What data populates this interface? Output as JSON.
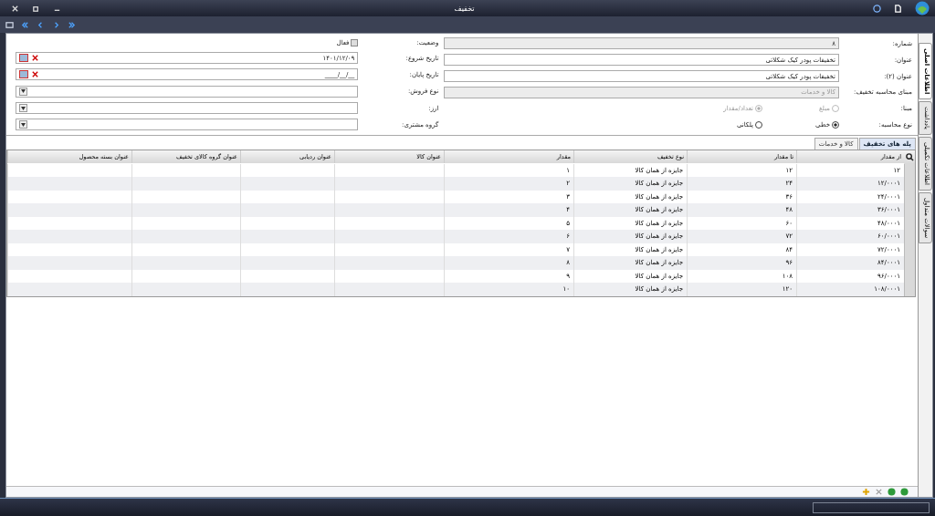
{
  "window": {
    "title": "تخفیف"
  },
  "side_tabs": [
    {
      "label": "اطلاعات اصلی",
      "selected": true
    },
    {
      "label": "یادداشت",
      "selected": false
    },
    {
      "label": "اطلاعات تکمیلی",
      "selected": false
    },
    {
      "label": "سوالات متداول",
      "selected": false
    }
  ],
  "form_right": [
    {
      "kind": "text",
      "label": "شماره:",
      "value": "۸",
      "disabled": true
    },
    {
      "kind": "text",
      "label": "عنوان:",
      "value": "تخفیفات پودر کیک شکلاتی",
      "disabled": false
    },
    {
      "kind": "text",
      "label": "عنوان (۲):",
      "value": "تخفیفات پودر کیک شکلاتی",
      "disabled": false
    },
    {
      "kind": "select",
      "label": "مبنای محاسبه تخفیف:",
      "value": "کالا و خدمات",
      "disabled": true
    },
    {
      "kind": "radio",
      "label": "مبنا:",
      "disabled": true,
      "options": [
        {
          "label": "مبلغ",
          "selected": false
        },
        {
          "label": "تعداد/مقدار",
          "selected": true
        }
      ]
    },
    {
      "kind": "radio",
      "label": "نوع محاسبه:",
      "disabled": false,
      "options": [
        {
          "label": "خطی",
          "selected": true
        },
        {
          "label": "پلکانی",
          "selected": false
        }
      ]
    }
  ],
  "form_left": [
    {
      "kind": "checkbox",
      "label": "وضعیت:",
      "option": "فعال",
      "checked": false
    },
    {
      "kind": "date",
      "label": "تاریخ شروع:",
      "value": "۱۴۰۱/۱۲/۰۹"
    },
    {
      "kind": "date",
      "label": "تاریخ پایان:",
      "value": "__/__/____"
    },
    {
      "kind": "select",
      "label": "نوع فروش:"
    },
    {
      "kind": "select",
      "label": "ارز:"
    },
    {
      "kind": "select",
      "label": "گروه مشتری:"
    }
  ],
  "grid_tabs": [
    {
      "label": "پله های تخفیف",
      "selected": true
    },
    {
      "label": "کالا و خدمات",
      "selected": false
    }
  ],
  "table": {
    "columns": [
      "از مقدار",
      "تا مقدار",
      "نوع تخفیف",
      "مقدار",
      "عنوان کالا",
      "عنوان ردیابی",
      "عنوان گروه کالای تخفیف",
      "عنوان بسته محصول"
    ],
    "rows": [
      [
        "۱۲",
        "۱۲",
        "جایزه از همان کالا",
        "۱"
      ],
      [
        "۱۲/۰۰۰۱",
        "۲۴",
        "جایزه از همان کالا",
        "۲"
      ],
      [
        "۲۴/۰۰۰۱",
        "۳۶",
        "جایزه از همان کالا",
        "۳"
      ],
      [
        "۳۶/۰۰۰۱",
        "۴۸",
        "جایزه از همان کالا",
        "۴"
      ],
      [
        "۴۸/۰۰۰۱",
        "۶۰",
        "جایزه از همان کالا",
        "۵"
      ],
      [
        "۶۰/۰۰۰۱",
        "۷۲",
        "جایزه از همان کالا",
        "۶"
      ],
      [
        "۷۲/۰۰۰۱",
        "۸۴",
        "جایزه از همان کالا",
        "۷"
      ],
      [
        "۸۴/۰۰۰۱",
        "۹۶",
        "جایزه از همان کالا",
        "۸"
      ],
      [
        "۹۶/۰۰۰۱",
        "۱۰۸",
        "جایزه از همان کالا",
        "۹"
      ],
      [
        "۱۰۸/۰۰۰۱",
        "۱۲۰",
        "جایزه از همان کالا",
        "۱۰"
      ]
    ]
  }
}
